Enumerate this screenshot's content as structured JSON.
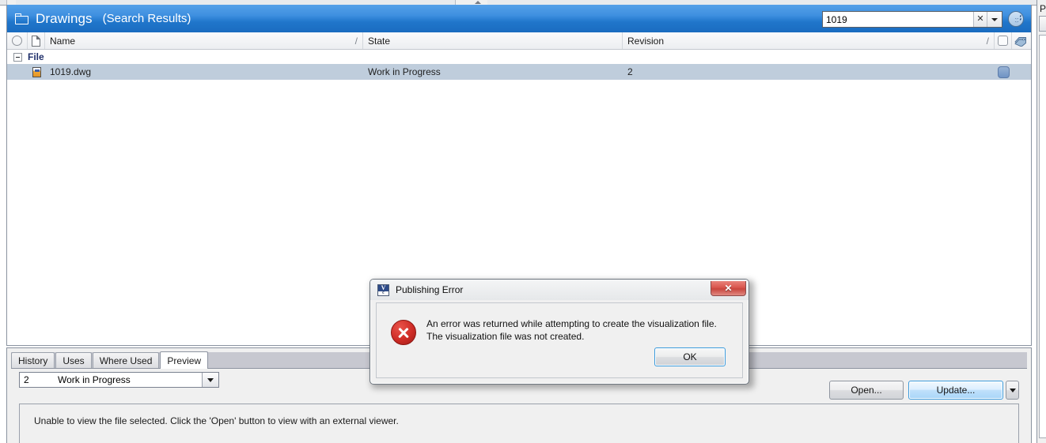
{
  "window": {
    "pane_title": "Drawings",
    "pane_subtitle": "(Search Results)",
    "folder_icon": "folder-icon",
    "expand_icon": "double-chevron-down-icon"
  },
  "search": {
    "value": "1019",
    "placeholder": "",
    "clear_label": "✕",
    "dropdown_icon": "chevron-down-icon"
  },
  "list": {
    "columns": [
      {
        "key": "select",
        "label": "",
        "icon": "circle-icon"
      },
      {
        "key": "doctype",
        "label": "",
        "icon": "document-icon"
      },
      {
        "key": "name",
        "label": "Name",
        "sortmark": "/"
      },
      {
        "key": "state",
        "label": "State"
      },
      {
        "key": "revision",
        "label": "Revision",
        "sortmark": "/"
      },
      {
        "key": "checkbox",
        "label": "",
        "icon": "rounded-checkbox-icon"
      },
      {
        "key": "tag",
        "label": "",
        "icon": "tag-icon"
      }
    ],
    "groups": [
      {
        "label": "File",
        "expanded": true,
        "rows": [
          {
            "name": "1019.dwg",
            "state": "Work in Progress",
            "revision": "2",
            "selected": true,
            "icon": "dwg-file-icon",
            "flag_icon": "blue-rounded-square-icon"
          }
        ]
      }
    ]
  },
  "bottom": {
    "tabs": [
      {
        "label": "History",
        "active": false
      },
      {
        "label": "Uses",
        "active": false
      },
      {
        "label": "Where Used",
        "active": false
      },
      {
        "label": "Preview",
        "active": true
      }
    ],
    "revision_combo": {
      "revision": "2",
      "state": "Work in Progress",
      "dropdown_icon": "chevron-down-icon"
    },
    "buttons": {
      "open": "Open...",
      "update": "Update...",
      "update_split_icon": "chevron-down-icon"
    },
    "preview_message": "Unable to view the file selected. Click the 'Open' button to view with an external viewer."
  },
  "right_panel": {
    "title": "P"
  },
  "dialog": {
    "title": "Publishing Error",
    "title_icon": "vault-app-icon",
    "icon_letters": {
      "top": "V",
      "bottom": "c"
    },
    "close_label": "✕",
    "error_icon": "error-cross-circle-icon",
    "message": "An error was returned while attempting to create the visualization file. The visualization file was not created.",
    "ok_label": "OK"
  },
  "colors": {
    "titlebar_blue_top": "#55a0e8",
    "titlebar_blue_bottom": "#1a6cc0",
    "row_selected": "#bfcddc",
    "group_label": "#20306b",
    "error_red": "#cf2c26",
    "panel_gray": "#f0f0f0",
    "tabstrip_gray": "#c7c8d0",
    "accent_focus": "#3c9bdc"
  }
}
